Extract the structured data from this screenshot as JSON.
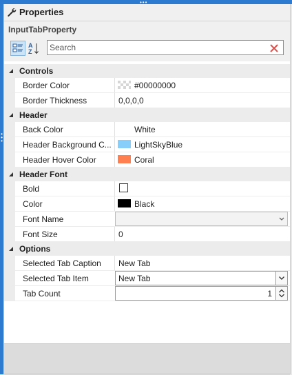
{
  "window": {
    "title": "Properties",
    "object_name": "InputTabProperty"
  },
  "toolbar": {
    "categorized_icon": "categorized-icon",
    "alphabetical_icon": "alphabetical-icon",
    "search_placeholder": "Search",
    "clear_icon": "clear-x-icon",
    "accent_color": "#2d7bd1"
  },
  "categories": {
    "controls": {
      "label": "Controls",
      "border_color": {
        "name": "Border Color",
        "value": "#00000000"
      },
      "border_thickness": {
        "name": "Border Thickness",
        "value": "0,0,0,0"
      }
    },
    "header": {
      "label": "Header",
      "back_color": {
        "name": "Back Color",
        "value": "White"
      },
      "header_bg": {
        "name": "Header Background C...",
        "value": "LightSkyBlue",
        "swatch": "#87cefa"
      },
      "header_hover": {
        "name": "Header Hover Color",
        "value": "Coral",
        "swatch": "#ff7f50"
      }
    },
    "header_font": {
      "label": "Header Font",
      "bold": {
        "name": "Bold",
        "checked": false
      },
      "color": {
        "name": "Color",
        "value": "Black",
        "swatch": "#000000"
      },
      "font_name": {
        "name": "Font Name",
        "value": ""
      },
      "font_size": {
        "name": "Font Size",
        "value": "0"
      }
    },
    "options": {
      "label": "Options",
      "selected_caption": {
        "name": "Selected Tab Caption",
        "value": "New Tab"
      },
      "selected_item": {
        "name": "Selected Tab Item",
        "value": "New Tab"
      },
      "tab_count": {
        "name": "Tab Count",
        "value": "1"
      }
    }
  }
}
